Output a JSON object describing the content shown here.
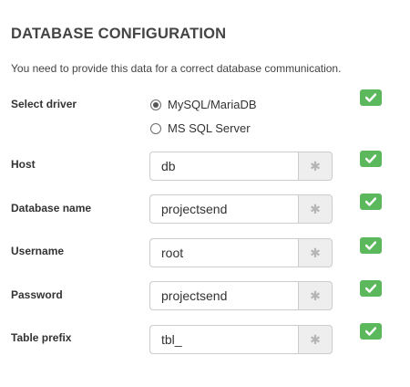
{
  "header": {
    "title": "DATABASE CONFIGURATION",
    "subtitle": "You need to provide this data for a correct database communication."
  },
  "driver": {
    "label": "Select driver",
    "options": [
      {
        "label": "MySQL/MariaDB",
        "checked": true
      },
      {
        "label": "MS SQL Server",
        "checked": false
      }
    ]
  },
  "fields": {
    "host": {
      "label": "Host",
      "value": "db"
    },
    "database_name": {
      "label": "Database name",
      "value": "projectsend"
    },
    "username": {
      "label": "Username",
      "value": "root"
    },
    "password": {
      "label": "Password",
      "value": "projectsend"
    },
    "table_prefix": {
      "label": "Table prefix",
      "value": "tbl_"
    }
  },
  "addon_icon": "asterisk-icon",
  "status_icon": "checkmark-icon",
  "colors": {
    "success": "#5cb85c",
    "addon_bg": "#eeeeee",
    "border": "#cccccc"
  }
}
